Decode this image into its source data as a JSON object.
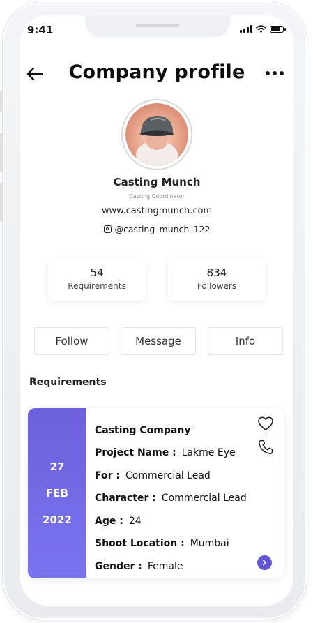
{
  "status_bar": {
    "time": "9:41"
  },
  "header": {
    "title": "Company profile"
  },
  "profile": {
    "name": "Casting Munch",
    "role": "Casting Coordinator",
    "website": "www.castingmunch.com",
    "instagram": "@casting_munch_122"
  },
  "stats": [
    {
      "value": "54",
      "label": "Requirements"
    },
    {
      "value": "834",
      "label": "Followers"
    }
  ],
  "actions": {
    "follow": "Follow",
    "message": "Message",
    "info": "Info"
  },
  "requirements": {
    "section_title": "Requirements",
    "card": {
      "date_day": "27",
      "date_month": "FEB",
      "date_year": "2022",
      "company": "Casting Company",
      "fields": [
        {
          "key": "Project Name :",
          "value": "Lakme Eye"
        },
        {
          "key": "For :",
          "value": "Commercial Lead"
        },
        {
          "key": "Character :",
          "value": "Commercial Lead"
        },
        {
          "key": "Age :",
          "value": "24"
        },
        {
          "key": "Shoot Location :",
          "value": "Mumbai"
        },
        {
          "key": "Gender :",
          "value": "Female"
        }
      ]
    }
  },
  "icons": [
    "back-arrow-icon",
    "more-icon",
    "instagram-icon",
    "heart-icon",
    "phone-icon",
    "chevron-right-icon"
  ],
  "colors": {
    "accent": "#6d60dc",
    "accent_light": "#7a74f0"
  }
}
